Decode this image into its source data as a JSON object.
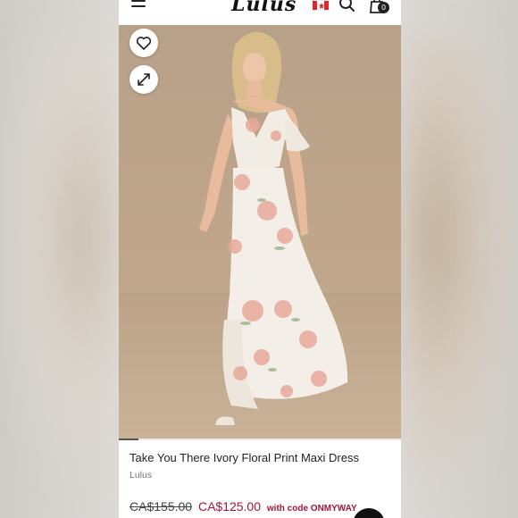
{
  "header": {
    "logo_text": "Lulus",
    "menu_icon": "hamburger-menu-icon",
    "flag_icon": "canada-flag-icon",
    "search_icon": "search-icon",
    "bag_icon": "shopping-bag-icon",
    "bag_count": "0"
  },
  "gallery": {
    "wishlist_icon": "heart-icon",
    "expand_icon": "expand-arrows-icon",
    "image_progress": 0.07
  },
  "product": {
    "title": "Take You There Ivory Floral Print Maxi Dress",
    "brand": "Lulus",
    "price_original": "CA$155.00",
    "price_sale": "CA$125.00",
    "promo_text": "with code ONMYWAY"
  },
  "colors": {
    "sale_price": "#a4173a",
    "dark": "#111111"
  }
}
